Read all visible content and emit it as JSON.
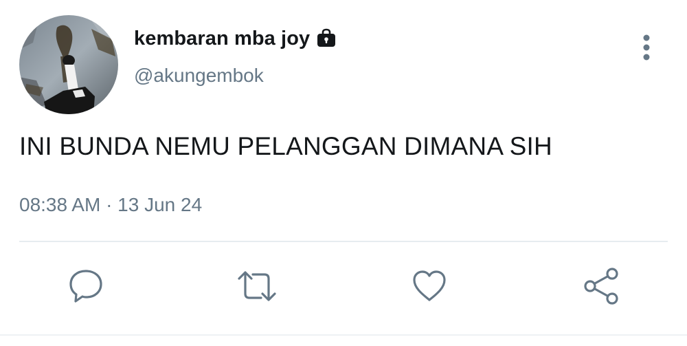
{
  "tweet": {
    "display_name": "kembaran mba joy",
    "handle": "@akungembok",
    "text": "INI BUNDA NEMU PELANGGAN DIMANA SIH",
    "timestamp": "08:38 AM · 13 Jun 24",
    "protected_icon": "lock-icon",
    "more_icon": "vertical-dots-icon"
  },
  "actions": [
    {
      "name": "reply",
      "icon": "reply-icon"
    },
    {
      "name": "retweet",
      "icon": "retweet-icon"
    },
    {
      "name": "like",
      "icon": "heart-icon"
    },
    {
      "name": "share",
      "icon": "share-icon"
    }
  ],
  "colors": {
    "text_primary": "#14171a",
    "text_secondary": "#657786",
    "icon": "#657786",
    "divider": "#e6ecf0"
  }
}
